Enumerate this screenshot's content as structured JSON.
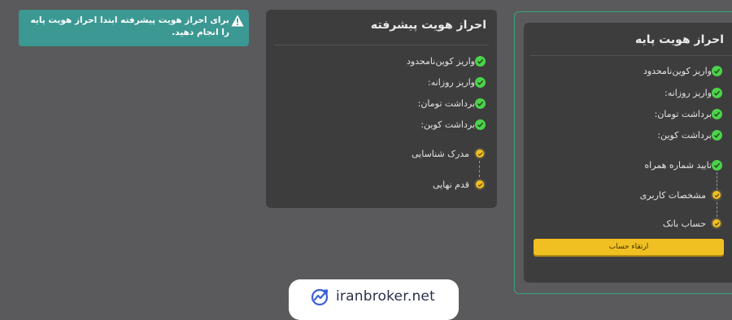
{
  "alert": {
    "icon": "warning-icon",
    "text": "برای احراز هویت پیشرفته ابتدا احراز هویت پایه را انجام دهید."
  },
  "advanced": {
    "title": "احراز هویت پیشرفته",
    "checks": [
      "واریز کوین‌نامحدود",
      "واریز روزانه:",
      "برداشت تومان:",
      "برداشت کوین:"
    ],
    "steps": [
      "مدرک شناسایی",
      "قدم نهایی"
    ]
  },
  "basic": {
    "title": "احراز هویت پایه",
    "checks": [
      "واریز کوین‌نامحدود",
      "واریز روزانه:",
      "برداشت تومان:",
      "برداشت کوین:"
    ],
    "steps": [
      "تایید شماره همراه",
      "مشخصات کاربری",
      "حساب بانک"
    ],
    "button_label": "ارتقاء حساب"
  },
  "brand": {
    "icon": "trend-logo-icon",
    "text": "iranbroker.net"
  },
  "colors": {
    "background": "#5a5a5c",
    "card": "#3d3d3e",
    "alert": "#3c9892",
    "check": "#4cd34a",
    "pending": "#f3c021",
    "accent_border": "#3aa37a"
  }
}
